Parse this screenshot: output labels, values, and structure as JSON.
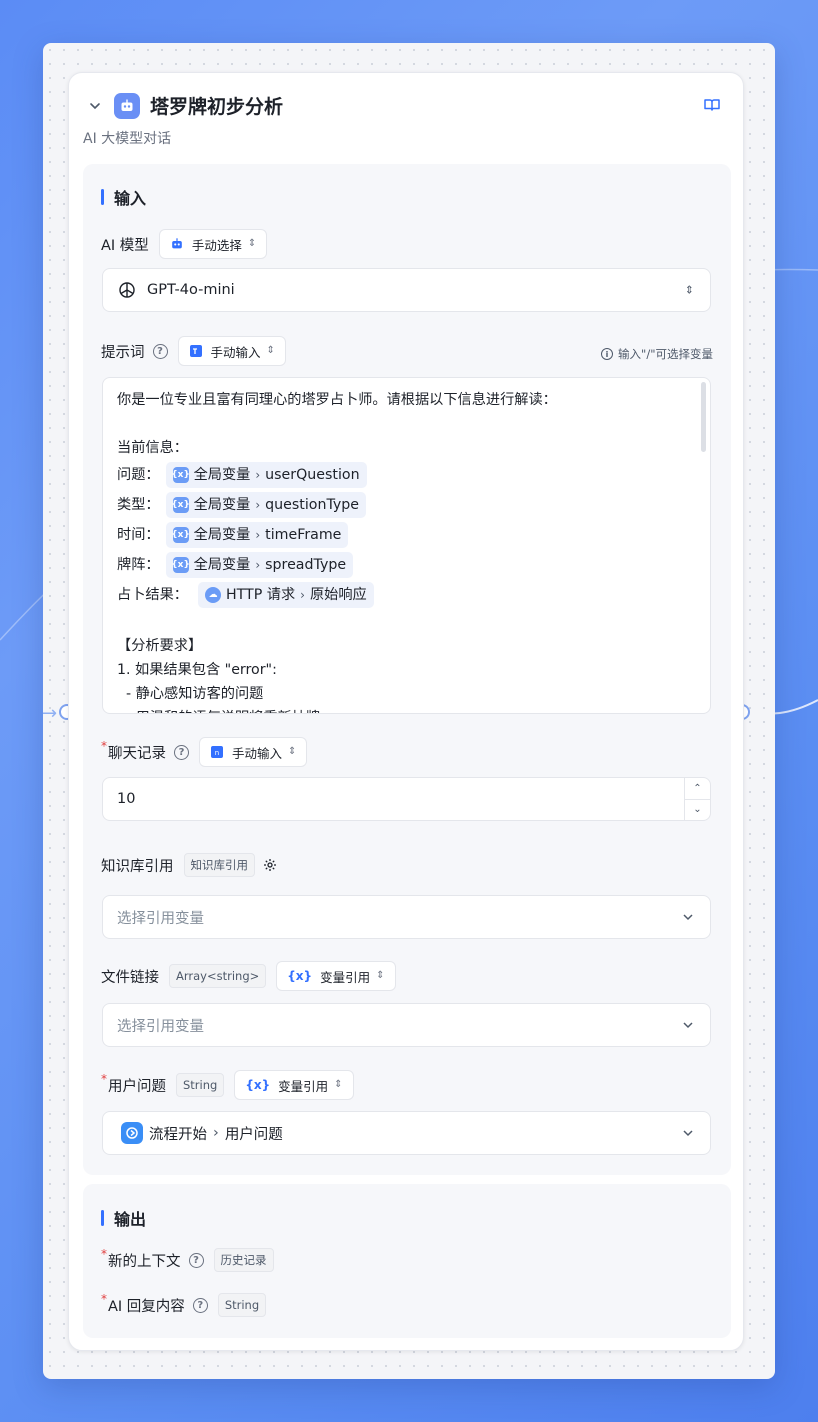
{
  "node": {
    "title": "塔罗牌初步分析",
    "subtitle": "AI 大模型对话"
  },
  "input": {
    "section_title": "输入",
    "ai_model": {
      "label": "AI 模型",
      "mode": "手动选择",
      "value": "GPT-4o-mini"
    },
    "prompt": {
      "label": "提示词",
      "mode": "手动输入",
      "hint": "输入\"/\"可选择变量",
      "intro": "你是一位专业且富有同理心的塔罗占卜师。请根据以下信息进行解读：",
      "info_header": "当前信息：",
      "vars": [
        {
          "label": "问题：",
          "scope": "全局变量",
          "name": "userQuestion"
        },
        {
          "label": "类型：",
          "scope": "全局变量",
          "name": "questionType"
        },
        {
          "label": "时间：",
          "scope": "全局变量",
          "name": "timeFrame"
        },
        {
          "label": "牌阵：",
          "scope": "全局变量",
          "name": "spreadType"
        },
        {
          "label": "占卜结果：",
          "scope": "HTTP 请求",
          "name": "原始响应"
        }
      ],
      "req_header": "【分析要求】",
      "req_line1": "1. 如果结果包含 \"error\":",
      "req_line2": "  - 静心感知访客的问题",
      "req_line3": "  - 用温和的语气说明将重新抽牌"
    },
    "chat_history": {
      "label": "聊天记录",
      "mode": "手动输入",
      "value": "10"
    },
    "knowledge": {
      "label": "知识库引用",
      "tag": "知识库引用",
      "placeholder": "选择引用变量"
    },
    "file_link": {
      "label": "文件链接",
      "tag": "Array<string>",
      "mode": "变量引用",
      "placeholder": "选择引用变量"
    },
    "user_question": {
      "label": "用户问题",
      "tag": "String",
      "mode": "变量引用",
      "source": "流程开始",
      "value": "用户问题"
    }
  },
  "output": {
    "section_title": "输出",
    "items": [
      {
        "label": "新的上下文",
        "tag": "历史记录"
      },
      {
        "label": "AI 回复内容",
        "tag": "String"
      }
    ]
  }
}
